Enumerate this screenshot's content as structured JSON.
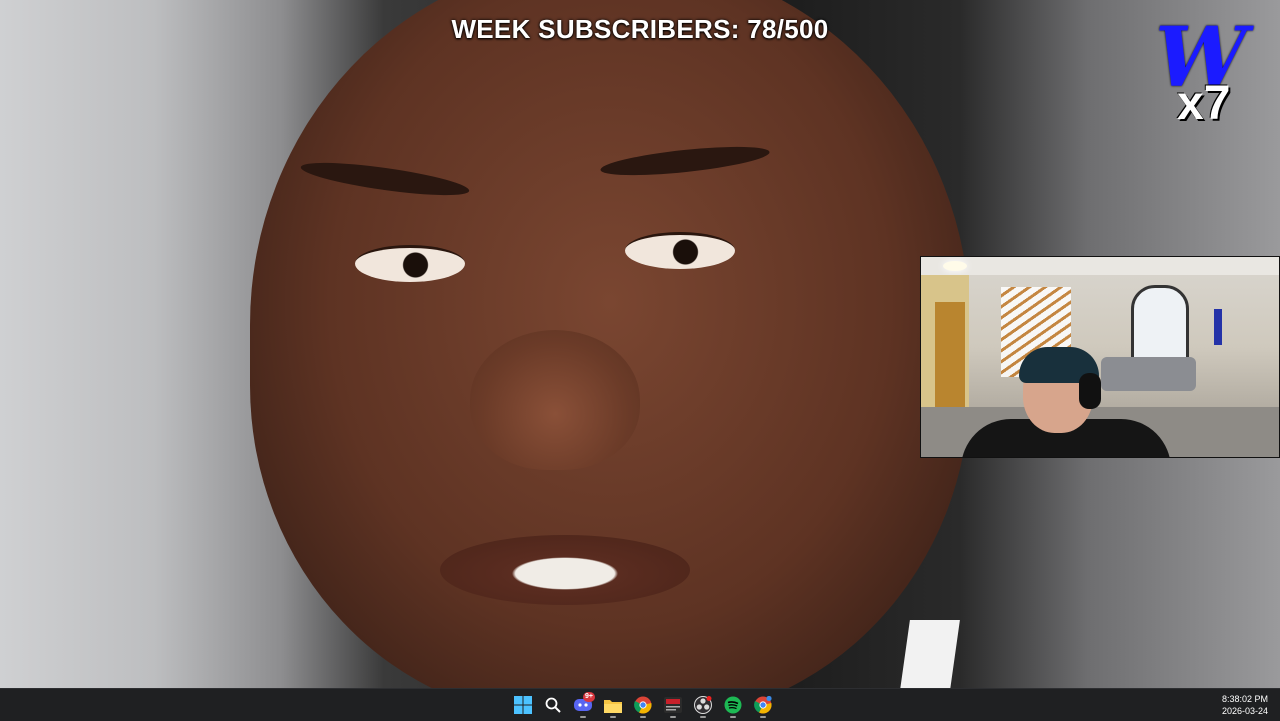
{
  "overlay": {
    "subscriber_counter": "WEEK SUBSCRIBERS: 78/500",
    "logo_letter": "W",
    "logo_suffix": "x7"
  },
  "colors": {
    "logo_blue": "#1b1bff",
    "taskbar_bg": "#1f2022",
    "discord": "#5865f2",
    "spotify": "#1db954"
  },
  "taskbar": {
    "icons": [
      {
        "name": "windows-start-icon"
      },
      {
        "name": "search-icon"
      },
      {
        "name": "discord-icon",
        "badge": "9+"
      },
      {
        "name": "file-explorer-icon"
      },
      {
        "name": "chrome-icon"
      },
      {
        "name": "media-app-icon"
      },
      {
        "name": "obs-icon"
      },
      {
        "name": "spotify-icon"
      },
      {
        "name": "chrome-alt-icon"
      }
    ],
    "time": "8:38:02 PM",
    "date": "2026-03-24"
  }
}
